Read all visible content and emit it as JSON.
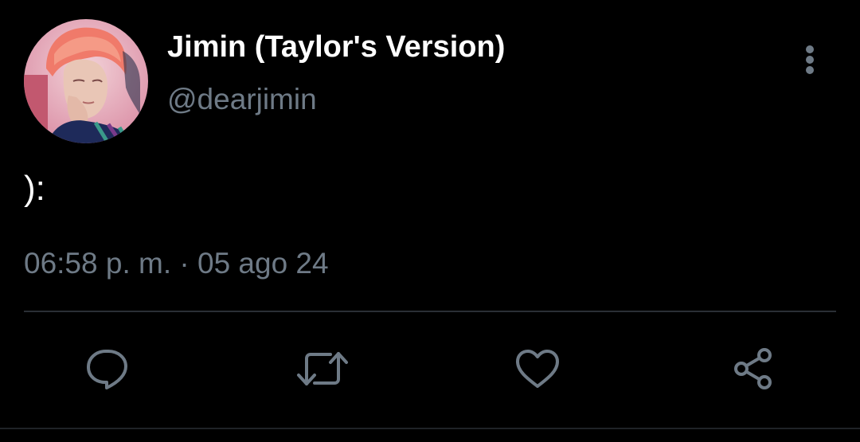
{
  "tweet": {
    "display_name": "Jimin (Taylor's Version)",
    "handle": "@dearjimin",
    "text": "):",
    "timestamp": "06:58 p. m. · 05 ago 24"
  },
  "icons": {
    "more": "vertical-ellipsis-icon",
    "reply": "speech-bubble-icon",
    "retweet": "retweet-arrows-icon",
    "like": "heart-outline-icon",
    "share": "share-nodes-icon"
  },
  "colors": {
    "background": "#000000",
    "primary_text": "#ffffff",
    "secondary_text": "#6e7a86",
    "icon": "#6e7a86",
    "divider": "#2a2f35"
  }
}
